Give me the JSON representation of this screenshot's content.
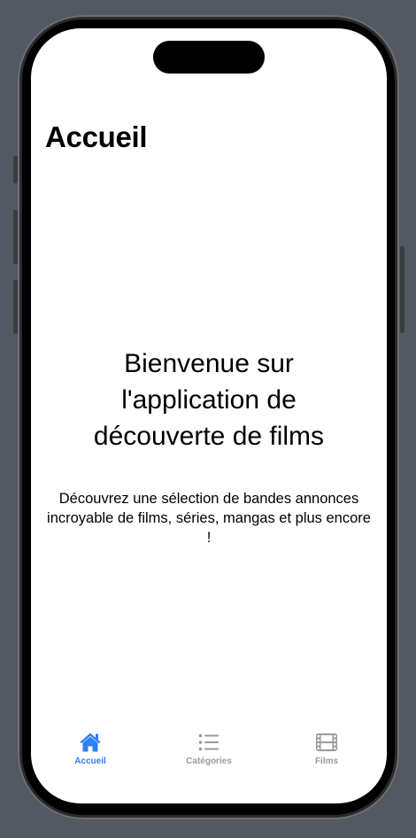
{
  "header": {
    "title": "Accueil"
  },
  "main": {
    "welcome_title": "Bienvenue sur l'application de découverte de films",
    "description": "Découvrez une sélection de bandes annonces incroyable de films, séries, mangas et plus encore !"
  },
  "tabbar": {
    "tabs": [
      {
        "label": "Accueil",
        "icon": "house-icon",
        "active": true
      },
      {
        "label": "Catégories",
        "icon": "list-icon",
        "active": false
      },
      {
        "label": "Films",
        "icon": "film-icon",
        "active": false
      }
    ]
  },
  "colors": {
    "accent": "#2f7ff6",
    "inactive": "#9a9a9a",
    "background": "#ffffff",
    "frame": "#545861"
  }
}
